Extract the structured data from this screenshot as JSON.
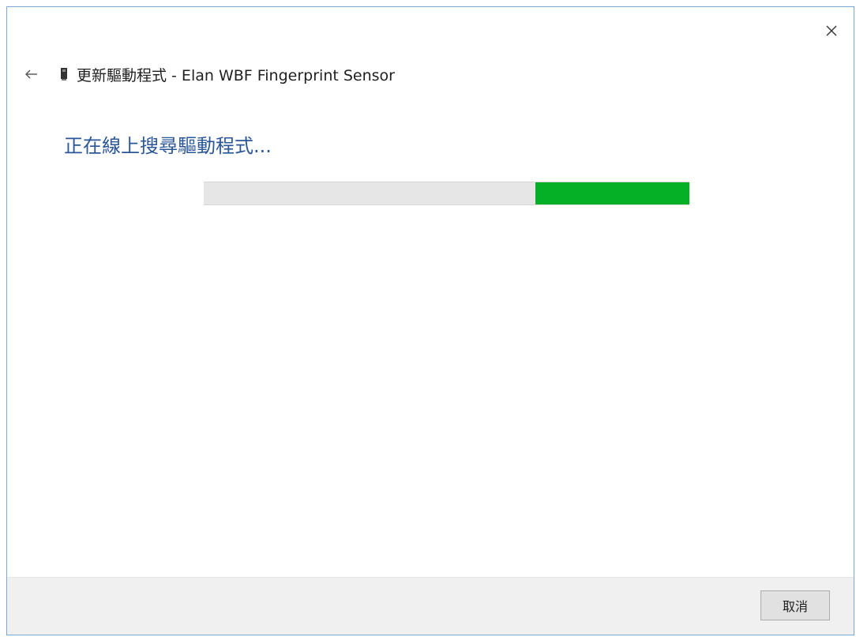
{
  "window": {
    "close_glyph": "✕"
  },
  "header": {
    "back_glyph": "←",
    "device_icon": "device-icon",
    "title": "更新驅動程式 - Elan WBF Fingerprint Sensor"
  },
  "main": {
    "status": "正在線上搜尋驅動程式...",
    "progress": {
      "start_fraction": 0.683,
      "end_fraction": 1.0,
      "fill_color": "#06b025",
      "track_color": "#e6e6e6"
    }
  },
  "footer": {
    "cancel_label": "取消"
  },
  "colors": {
    "status_text": "#2b5797",
    "footer_bg": "#f0f0f0",
    "window_border": "#7aa7d6"
  }
}
